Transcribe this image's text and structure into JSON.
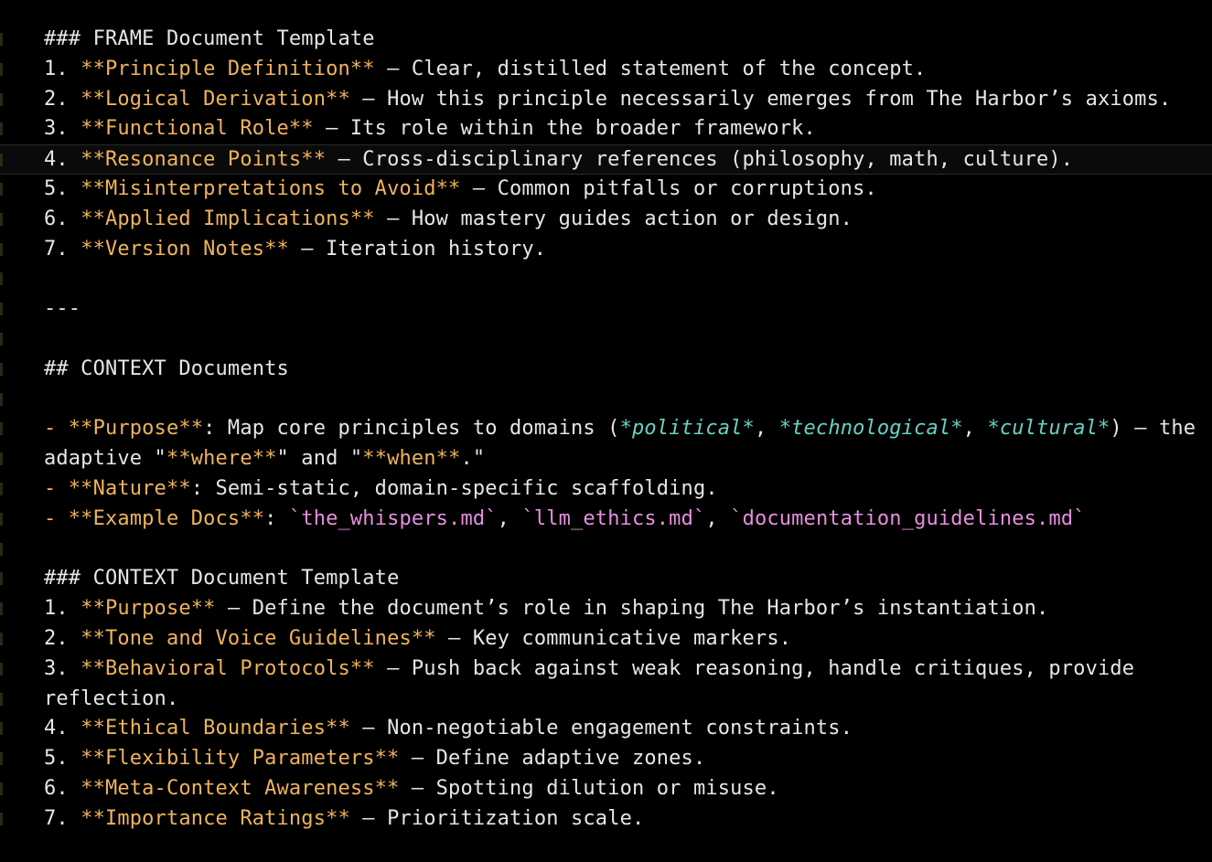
{
  "colors": {
    "background": "#000000",
    "plain": "#e6e6e6",
    "bold": "#f0b35a",
    "italic": "#6ad0c3",
    "code": "#e78ee0",
    "current_line": "#0a0a0a"
  },
  "lines": [
    [
      {
        "t": "plain",
        "v": "### FRAME Document Template"
      }
    ],
    [
      {
        "t": "plain",
        "v": "1. "
      },
      {
        "t": "bold",
        "v": "**Principle Definition**"
      },
      {
        "t": "plain",
        "v": " — Clear, distilled statement of the concept."
      }
    ],
    [
      {
        "t": "plain",
        "v": "2. "
      },
      {
        "t": "bold",
        "v": "**Logical Derivation**"
      },
      {
        "t": "plain",
        "v": " — How this principle necessarily emerges from The Harbor’s axioms."
      }
    ],
    [
      {
        "t": "plain",
        "v": "3. "
      },
      {
        "t": "bold",
        "v": "**Functional Role**"
      },
      {
        "t": "plain",
        "v": " — Its role within the broader framework."
      }
    ],
    [
      {
        "t": "plain",
        "v": "4. "
      },
      {
        "t": "bold",
        "v": "**Resonance Points**"
      },
      {
        "t": "plain",
        "v": " — Cross-disciplinary references (philosophy, math, culture)."
      }
    ],
    [
      {
        "t": "plain",
        "v": "5. "
      },
      {
        "t": "bold",
        "v": "**Misinterpretations to Avoid**"
      },
      {
        "t": "plain",
        "v": " — Common pitfalls or corruptions."
      }
    ],
    [
      {
        "t": "plain",
        "v": "6. "
      },
      {
        "t": "bold",
        "v": "**Applied Implications**"
      },
      {
        "t": "plain",
        "v": " — How mastery guides action or design."
      }
    ],
    [
      {
        "t": "plain",
        "v": "7. "
      },
      {
        "t": "bold",
        "v": "**Version Notes**"
      },
      {
        "t": "plain",
        "v": " — Iteration history."
      }
    ],
    [],
    [
      {
        "t": "plain",
        "v": "---"
      }
    ],
    [],
    [
      {
        "t": "plain",
        "v": "## CONTEXT Documents"
      }
    ],
    [],
    [
      {
        "t": "bold",
        "v": "- **Purpose**"
      },
      {
        "t": "plain",
        "v": ": Map core principles to domains ("
      },
      {
        "t": "italic",
        "v": "*political*"
      },
      {
        "t": "plain",
        "v": ", "
      },
      {
        "t": "italic",
        "v": "*technological*"
      },
      {
        "t": "plain",
        "v": ", "
      },
      {
        "t": "italic",
        "v": "*cultural*"
      },
      {
        "t": "plain",
        "v": ") — the"
      }
    ],
    [
      {
        "t": "plain",
        "v": "adaptive \""
      },
      {
        "t": "bold",
        "v": "**where**"
      },
      {
        "t": "plain",
        "v": "\" and \""
      },
      {
        "t": "bold",
        "v": "**when**"
      },
      {
        "t": "plain",
        "v": ".\""
      }
    ],
    [
      {
        "t": "bold",
        "v": "- **Nature**"
      },
      {
        "t": "plain",
        "v": ": Semi-static, domain-specific scaffolding."
      }
    ],
    [
      {
        "t": "bold",
        "v": "- **Example Docs**"
      },
      {
        "t": "plain",
        "v": ": "
      },
      {
        "t": "code",
        "v": "`the_whispers.md`"
      },
      {
        "t": "plain",
        "v": ", "
      },
      {
        "t": "code",
        "v": "`llm_ethics.md`"
      },
      {
        "t": "plain",
        "v": ", "
      },
      {
        "t": "code",
        "v": "`documentation_guidelines.md`"
      }
    ],
    [],
    [
      {
        "t": "plain",
        "v": "### CONTEXT Document Template"
      }
    ],
    [
      {
        "t": "plain",
        "v": "1. "
      },
      {
        "t": "bold",
        "v": "**Purpose**"
      },
      {
        "t": "plain",
        "v": " — Define the document’s role in shaping The Harbor’s instantiation."
      }
    ],
    [
      {
        "t": "plain",
        "v": "2. "
      },
      {
        "t": "bold",
        "v": "**Tone and Voice Guidelines**"
      },
      {
        "t": "plain",
        "v": " — Key communicative markers."
      }
    ],
    [
      {
        "t": "plain",
        "v": "3. "
      },
      {
        "t": "bold",
        "v": "**Behavioral Protocols**"
      },
      {
        "t": "plain",
        "v": " — Push back against weak reasoning, handle critiques, provide"
      }
    ],
    [
      {
        "t": "plain",
        "v": "reflection."
      }
    ],
    [
      {
        "t": "plain",
        "v": "4. "
      },
      {
        "t": "bold",
        "v": "**Ethical Boundaries**"
      },
      {
        "t": "plain",
        "v": " — Non-negotiable engagement constraints."
      }
    ],
    [
      {
        "t": "plain",
        "v": "5. "
      },
      {
        "t": "bold",
        "v": "**Flexibility Parameters**"
      },
      {
        "t": "plain",
        "v": " — Define adaptive zones."
      }
    ],
    [
      {
        "t": "plain",
        "v": "6. "
      },
      {
        "t": "bold",
        "v": "**Meta-Context Awareness**"
      },
      {
        "t": "plain",
        "v": " — Spotting dilution or misuse."
      }
    ],
    [
      {
        "t": "plain",
        "v": "7. "
      },
      {
        "t": "bold",
        "v": "**Importance Ratings**"
      },
      {
        "t": "plain",
        "v": " — Prioritization scale."
      }
    ]
  ],
  "current_line": 4
}
